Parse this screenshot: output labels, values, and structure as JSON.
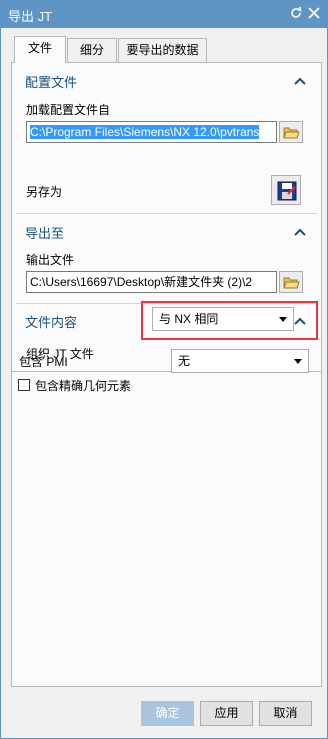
{
  "window": {
    "title": "导出 JT"
  },
  "tabs": [
    {
      "label": "文件"
    },
    {
      "label": "细分"
    },
    {
      "label": "要导出的数据"
    }
  ],
  "config_section": {
    "title": "配置文件",
    "load_label": "加载配置文件自",
    "load_path": "C:\\Program Files\\Siemens\\NX 12.0\\pvtrans",
    "save_as_label": "另存为"
  },
  "export_section": {
    "title": "导出至",
    "output_label": "输出文件",
    "output_path": "C:\\Users\\16697\\Desktop\\新建文件夹 (2)\\2"
  },
  "content_section": {
    "title": "文件内容",
    "organize_label": "组织 JT 文件",
    "organize_value": "与 NX 相同"
  },
  "pmi": {
    "label": "包含 PMI",
    "value": "无"
  },
  "precise_geometry": {
    "label": "包含精确几何元素",
    "checked": false
  },
  "buttons": {
    "ok": "确定",
    "apply": "应用",
    "cancel": "取消"
  },
  "colors": {
    "titlebar": "#5e95c4",
    "section_title": "#1b4f7c",
    "highlight": "#e8383d",
    "selection": "#3399ff"
  }
}
